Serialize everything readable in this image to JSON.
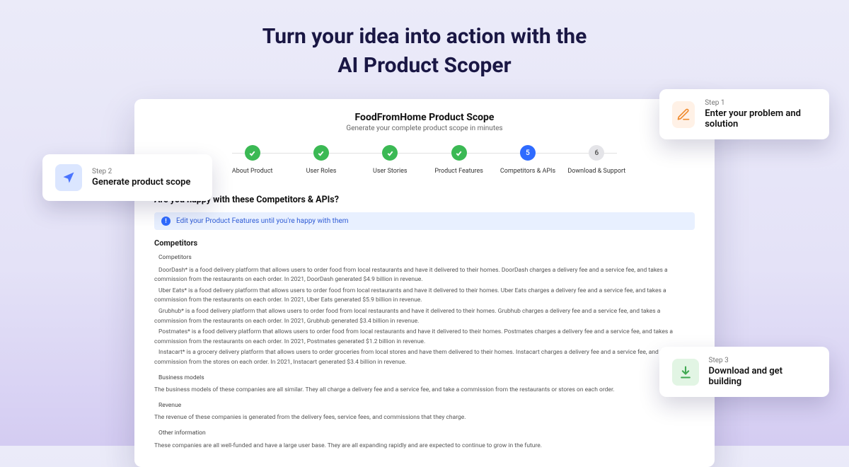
{
  "headline_l1": "Turn your idea into action with the",
  "headline_l2": "AI Product Scoper",
  "app": {
    "title": "FoodFromHome Product Scope",
    "subtitle": "Generate your complete product scope in minutes",
    "steps": [
      {
        "label": "About Product",
        "state": "done"
      },
      {
        "label": "User Roles",
        "state": "done"
      },
      {
        "label": "User Stories",
        "state": "done"
      },
      {
        "label": "Product Features",
        "state": "done"
      },
      {
        "label": "Competitors & APIs",
        "state": "active",
        "num": "5"
      },
      {
        "label": "Download & Support",
        "state": "future",
        "num": "6"
      }
    ],
    "question": "Are you happy with these Competitors & APIs?",
    "banner": "Edit your Product Features until you're happy with them",
    "competitors_heading": "Competitors",
    "body": {
      "h1": "Competitors",
      "p1": "DoorDash* is a food delivery platform that allows users to order food from local restaurants and have it delivered to their homes. DoorDash charges a delivery fee and a service fee, and takes a commission from the restaurants on each order. In 2021, DoorDash generated $4.9 billion in revenue.",
      "p2": "Uber Eats* is a food delivery platform that allows users to order food from local restaurants and have it delivered to their homes. Uber Eats charges a delivery fee and a service fee, and takes a commission from the restaurants on each order. In 2021, Uber Eats generated $5.9 billion in revenue.",
      "p3": "Grubhub* is a food delivery platform that allows users to order food from local restaurants and have it delivered to their homes. Grubhub charges a delivery fee and a service fee, and takes a commission from the restaurants on each order. In 2021, Grubhub generated $3.4 billion in revenue.",
      "p4": "Postmates* is a food delivery platform that allows users to order food from local restaurants and have it delivered to their homes. Postmates charges a delivery fee and a service fee, and takes a commission from the restaurants on each order. In 2021, Postmates generated $1.2 billion in revenue.",
      "p5": "Instacart* is a grocery delivery platform that allows users to order groceries from local stores and have them delivered to their homes. Instacart charges a delivery fee and a service fee, and takes a commission from the stores on each order. In 2021, Instacart generated $3.4 billion in revenue.",
      "h2": "Business models",
      "p6": "The business models of these companies are all similar. They all charge a delivery fee and a service fee, and take a commission from the restaurants or stores on each order.",
      "h3": "Revenue",
      "p7": "The revenue of these companies is generated from the delivery fees, service fees, and commissions that they charge.",
      "h4": "Other information",
      "p8": "These companies are all well-funded and have a large user base. They are all expanding rapidly and are expected to continue to grow in the future."
    }
  },
  "cards": {
    "c1": {
      "k": "Step 1",
      "t": "Enter your problem and solution"
    },
    "c2": {
      "k": "Step 2",
      "t": "Generate product scope"
    },
    "c3": {
      "k": "Step 3",
      "t": "Download and get building"
    }
  }
}
